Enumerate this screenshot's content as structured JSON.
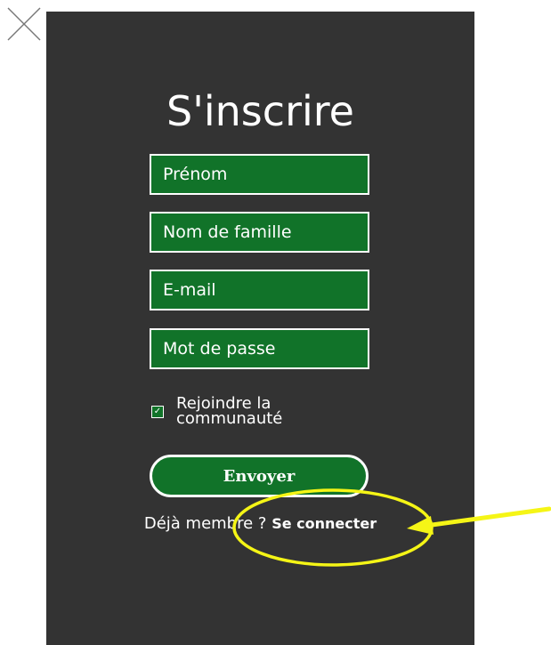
{
  "dialog": {
    "title": "S'inscrire",
    "fields": {
      "first_name_placeholder": "Prénom",
      "last_name_placeholder": "Nom de famille",
      "email_placeholder": "E-mail",
      "password_placeholder": "Mot de passe"
    },
    "join_community": {
      "label": "Rejoindre la communauté",
      "checked": true
    },
    "submit_label": "Envoyer",
    "login_prompt": "Déjà membre ?",
    "login_link": "Se connecter"
  },
  "colors": {
    "panel_bg": "#333333",
    "field_bg": "#117329",
    "highlight": "#f5f516"
  },
  "icons": {
    "close": "close-icon",
    "checkbox": "check-icon"
  }
}
